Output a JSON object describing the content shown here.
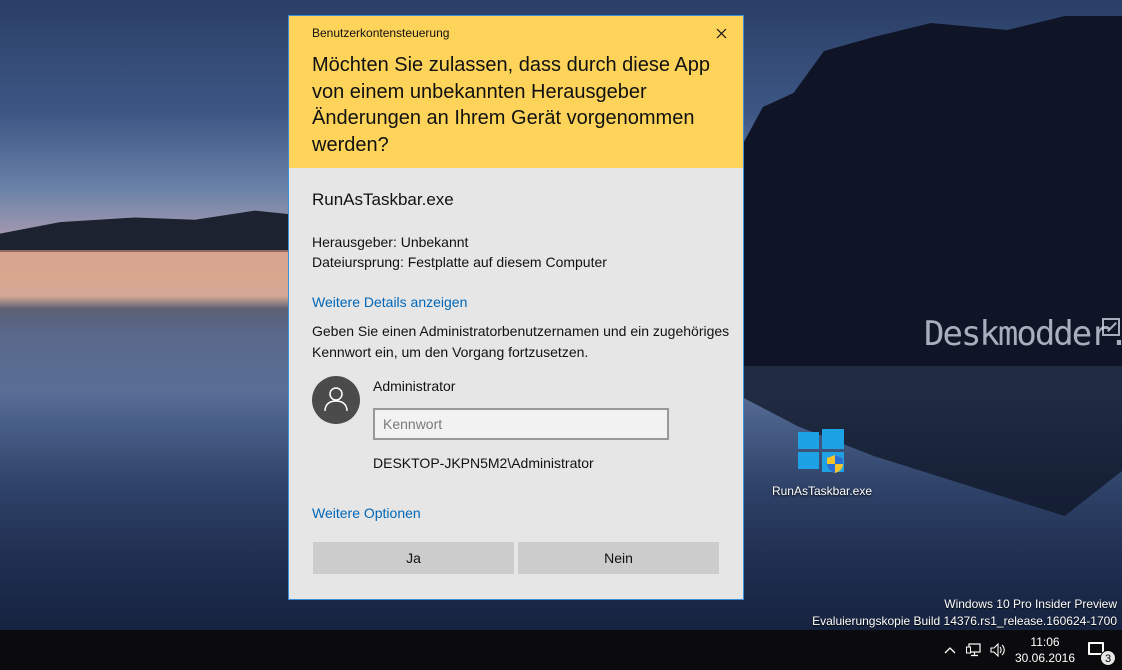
{
  "dialog": {
    "title": "Benutzerkontensteuerung",
    "question": "Möchten Sie zulassen, dass durch diese App von einem unbekannten Herausgeber Änderungen an Ihrem Gerät vorgenommen werden?",
    "app_name": "RunAsTaskbar.exe",
    "publisher": "Herausgeber: Unbekannt",
    "origin": "Dateiursprung: Festplatte auf diesem Computer",
    "more_details": "Weitere Details anzeigen",
    "prompt": "Geben Sie einen Administratorbenutzernamen und ein zugehöriges Kennwort ein, um den Vorgang fortzusetzen.",
    "username": "Administrator",
    "password": {
      "value": "",
      "placeholder": "Kennwort"
    },
    "domain_user": "DESKTOP-JKPN5M2\\Administrator",
    "more_options": "Weitere Optionen",
    "yes_label": "Ja",
    "no_label": "Nein",
    "header_color": "#fdd35a",
    "link_color": "#0067b8"
  },
  "desktop": {
    "watermark": "Deskmodder.de",
    "icon_label": "RunAsTaskbar.exe",
    "build_line1": "Windows 10 Pro Insider Preview",
    "build_line2": "Evaluierungskopie Build 14376.rs1_release.160624-1700"
  },
  "taskbar": {
    "time": "11:06",
    "date": "30.06.2016",
    "notifications": "3",
    "tray_icons": [
      "chevron-up-icon",
      "network-icon",
      "volume-icon"
    ]
  }
}
